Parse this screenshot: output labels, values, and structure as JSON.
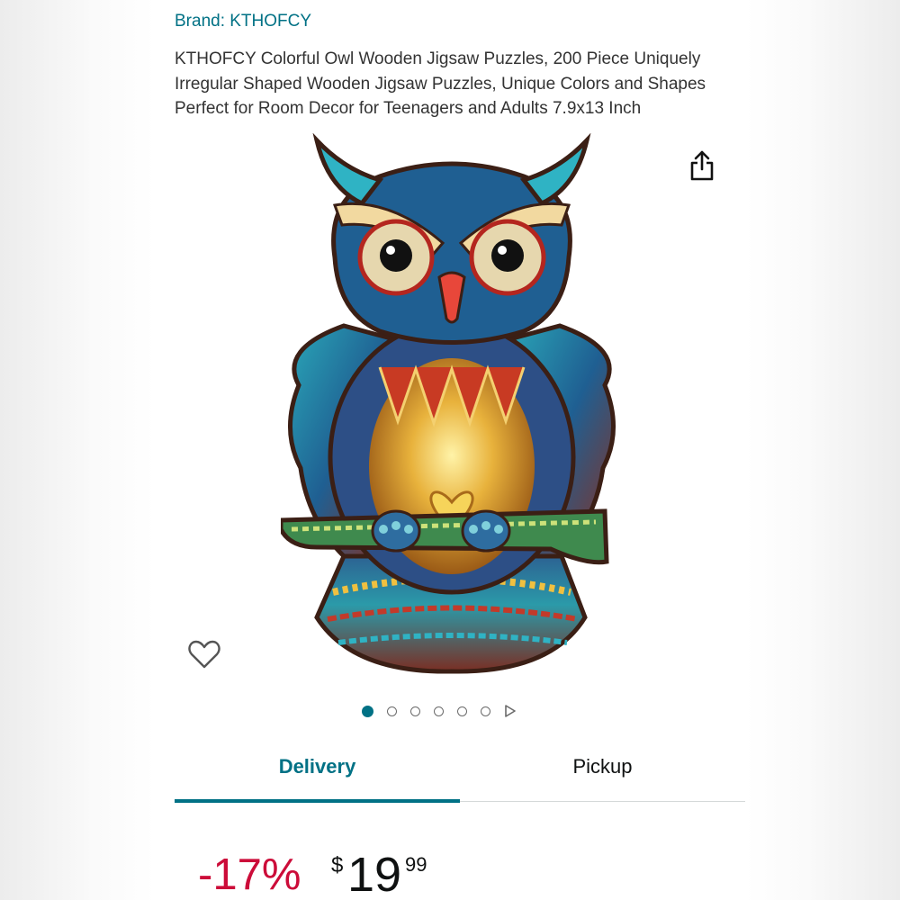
{
  "product": {
    "brand_label": "Brand: KTHOFCY",
    "title": "KTHOFCY Colorful Owl Wooden Jigsaw Puzzles, 200 Piece Uniquely Irregular Shaped Wooden Jigsaw Puzzles, Unique Colors and Shapes Perfect for Room Decor for Teenagers and Adults 7.9x13 Inch"
  },
  "gallery": {
    "image_count": 6,
    "active_index": 0,
    "share_icon": "share-icon",
    "wishlist_icon": "heart-outline-icon",
    "next_icon": "play-triangle-icon"
  },
  "tabs": [
    {
      "label": "Delivery",
      "active": true
    },
    {
      "label": "Pickup",
      "active": false
    }
  ],
  "price": {
    "discount": "-17%",
    "currency": "$",
    "whole": "19",
    "fraction": "99"
  },
  "colors": {
    "accent": "#007185",
    "discount": "#CC0C39",
    "text": "#0F1111"
  }
}
